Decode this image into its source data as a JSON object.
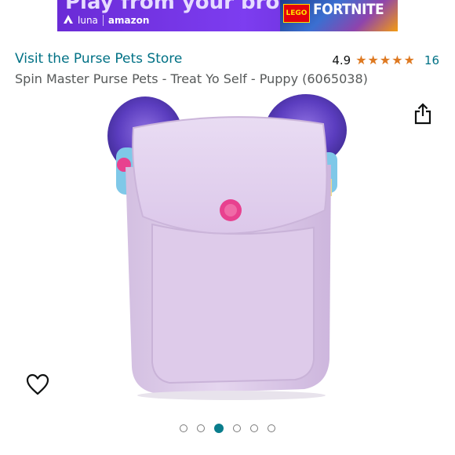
{
  "ad_banner": {
    "headline": "Play from your browser",
    "brand_luna": "luna",
    "brand_amazon": "amazon",
    "badge_lego": "LEGO",
    "badge_fortnite": "FORTNITE"
  },
  "store": {
    "link_text": "Visit the Purse Pets Store"
  },
  "rating": {
    "value": "4.9",
    "stars": 4.9,
    "max_stars": 5,
    "review_count": "16"
  },
  "product": {
    "title": "Spin Master Purse Pets - Treat Yo Self - Puppy (6065038)"
  },
  "icons": {
    "share": "share-icon",
    "wishlist": "heart-outline-icon",
    "luna": "luna-logo-icon"
  },
  "carousel": {
    "total": 6,
    "active_index": 3
  },
  "colors": {
    "link": "#007185",
    "star": "#de7921",
    "title": "#565959",
    "dot_active": "#0a7d8c",
    "purse_body": "#dcc8e8",
    "glitter_ears": "#6a4bc4",
    "snap_button": "#e8418f"
  }
}
